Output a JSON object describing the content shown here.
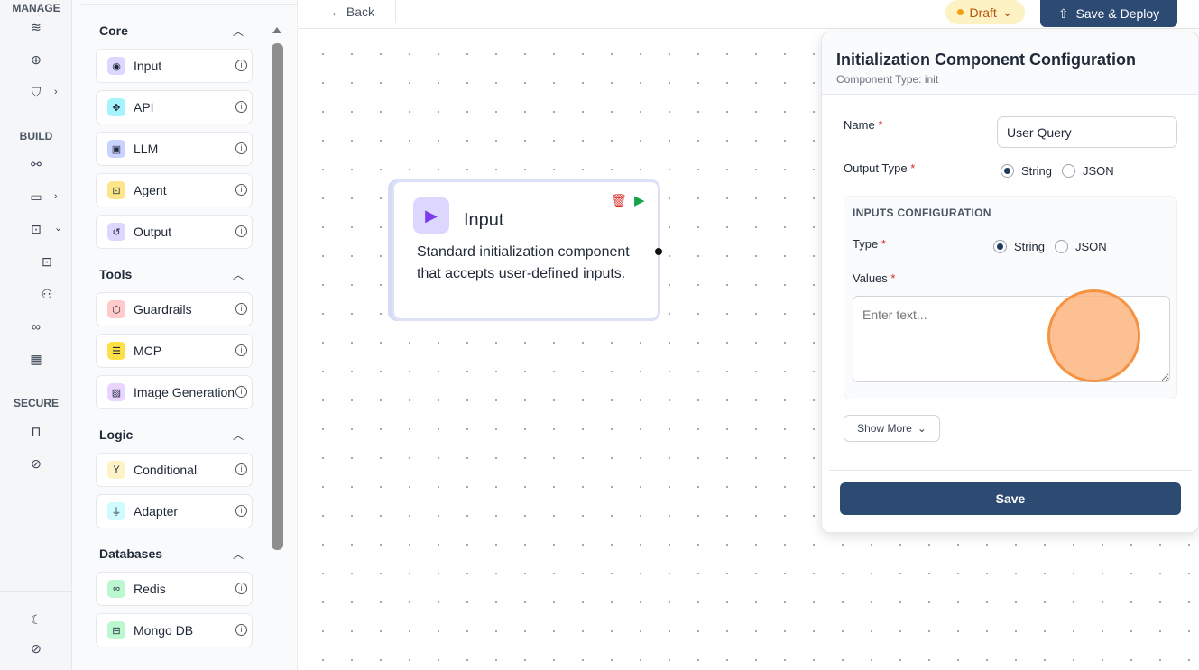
{
  "rail": {
    "sections": [
      "MANAGE",
      "BUILD",
      "SECURE"
    ]
  },
  "palette": {
    "groups": [
      {
        "title": "Core",
        "items": [
          {
            "label": "Input",
            "icon": "play-circle-icon",
            "color": "#ddd6fe"
          },
          {
            "label": "API",
            "icon": "api-icon",
            "color": "#a5f3fc"
          },
          {
            "label": "LLM",
            "icon": "terminal-icon",
            "color": "#c7d2fe"
          },
          {
            "label": "Agent",
            "icon": "bot-icon",
            "color": "#fde68a"
          },
          {
            "label": "Output",
            "icon": "output-icon",
            "color": "#ddd6fe"
          }
        ]
      },
      {
        "title": "Tools",
        "items": [
          {
            "label": "Guardrails",
            "icon": "shield-icon",
            "color": "#fecaca"
          },
          {
            "label": "MCP",
            "icon": "server-icon",
            "color": "#fde047"
          },
          {
            "label": "Image Generation",
            "icon": "image-icon",
            "color": "#e9d5ff"
          }
        ]
      },
      {
        "title": "Logic",
        "items": [
          {
            "label": "Conditional",
            "icon": "split-icon",
            "color": "#fef3c7"
          },
          {
            "label": "Adapter",
            "icon": "plug-icon",
            "color": "#cffafe"
          }
        ]
      },
      {
        "title": "Databases",
        "items": [
          {
            "label": "Redis",
            "icon": "redis-icon",
            "color": "#bbf7d0"
          },
          {
            "label": "Mongo DB",
            "icon": "database-icon",
            "color": "#bbf7d0"
          }
        ]
      }
    ]
  },
  "topbar": {
    "back": "← Back",
    "status": "Draft",
    "deploy": "Save & Deploy"
  },
  "node": {
    "title": "Input",
    "description": "Standard initialization component that accepts user-defined inputs."
  },
  "config": {
    "title": "Initialization Component Configuration",
    "subtitle": "Component Type: init",
    "name_label": "Name",
    "name_value": "User Query",
    "output_type_label": "Output Type",
    "options": [
      "String",
      "JSON"
    ],
    "output_type_selected": "String",
    "inputs_title": "INPUTS CONFIGURATION",
    "type_label": "Type",
    "type_selected": "String",
    "values_label": "Values",
    "values_placeholder": "Enter text...",
    "show_more": "Show More",
    "save": "Save",
    "required_mark": "*"
  }
}
